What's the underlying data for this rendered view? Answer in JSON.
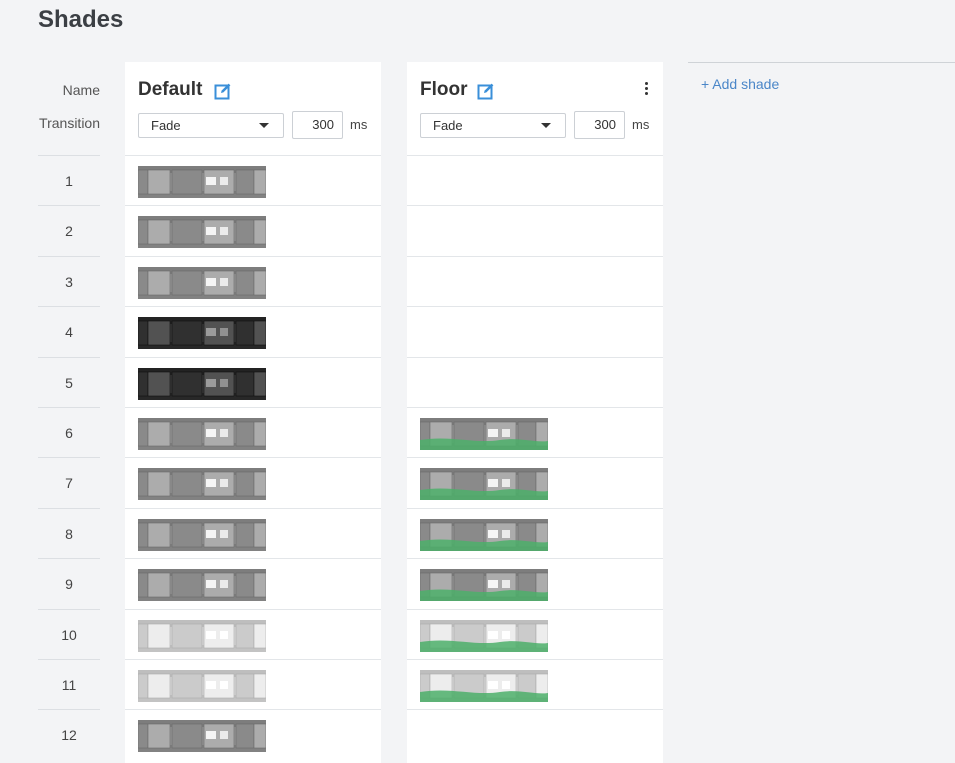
{
  "page": {
    "title": "Shades"
  },
  "labels": {
    "name": "Name",
    "transition": "Transition"
  },
  "rows": [
    "1",
    "2",
    "3",
    "4",
    "5",
    "6",
    "7",
    "8",
    "9",
    "10",
    "11",
    "12"
  ],
  "shades": [
    {
      "name": "Default",
      "transition": {
        "type": "Fade",
        "duration": "300",
        "unit": "ms"
      },
      "has_menu": false,
      "thumbnails": [
        {
          "row": "1",
          "tint": "gray",
          "brightness": "mid"
        },
        {
          "row": "2",
          "tint": "gray",
          "brightness": "mid"
        },
        {
          "row": "3",
          "tint": "gray",
          "brightness": "mid"
        },
        {
          "row": "4",
          "tint": "gray",
          "brightness": "dark"
        },
        {
          "row": "5",
          "tint": "gray",
          "brightness": "dark"
        },
        {
          "row": "6",
          "tint": "gray",
          "brightness": "mid"
        },
        {
          "row": "7",
          "tint": "gray",
          "brightness": "mid"
        },
        {
          "row": "8",
          "tint": "gray",
          "brightness": "mid"
        },
        {
          "row": "9",
          "tint": "gray",
          "brightness": "mid"
        },
        {
          "row": "10",
          "tint": "gray",
          "brightness": "light"
        },
        {
          "row": "11",
          "tint": "gray",
          "brightness": "light"
        },
        {
          "row": "12",
          "tint": "gray",
          "brightness": "mid"
        }
      ]
    },
    {
      "name": "Floor",
      "transition": {
        "type": "Fade",
        "duration": "300",
        "unit": "ms"
      },
      "has_menu": true,
      "thumbnails": [
        {
          "row": "6",
          "tint": "green",
          "brightness": "mid"
        },
        {
          "row": "7",
          "tint": "green",
          "brightness": "mid"
        },
        {
          "row": "8",
          "tint": "green",
          "brightness": "mid"
        },
        {
          "row": "9",
          "tint": "green",
          "brightness": "mid"
        },
        {
          "row": "10",
          "tint": "green",
          "brightness": "light"
        },
        {
          "row": "11",
          "tint": "green",
          "brightness": "light"
        }
      ]
    }
  ],
  "add_shade": {
    "label": "+ Add shade"
  },
  "colors": {
    "accent": "#4a86c8",
    "edit_icon": "#3a8fd9",
    "floor_green": "#4caf6a"
  },
  "icons": {
    "edit": "edit-icon",
    "more": "more-vertical-icon",
    "caret": "chevron-down-icon"
  }
}
